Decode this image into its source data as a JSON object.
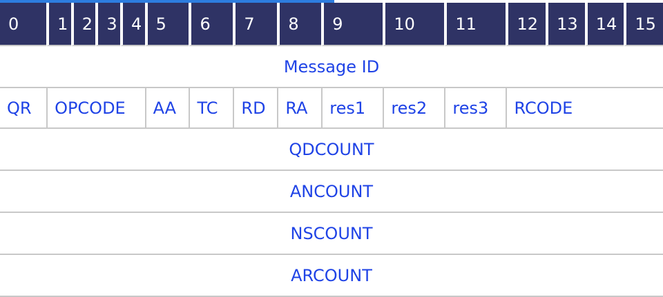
{
  "diagram": {
    "bit_positions": [
      "0",
      "1",
      "2",
      "3",
      "4",
      "5",
      "6",
      "7",
      "8",
      "9",
      "10",
      "11",
      "12",
      "13",
      "14",
      "15"
    ],
    "rows": [
      {
        "type": "full",
        "label": "Message ID"
      },
      {
        "type": "flags",
        "fields": [
          {
            "label": "QR",
            "span": 1
          },
          {
            "label": "OPCODE",
            "span": 4
          },
          {
            "label": "AA",
            "span": 1
          },
          {
            "label": "TC",
            "span": 1
          },
          {
            "label": "RD",
            "span": 1
          },
          {
            "label": "RA",
            "span": 1
          },
          {
            "label": "res1",
            "span": 1
          },
          {
            "label": "res2",
            "span": 1
          },
          {
            "label": "res3",
            "span": 1
          },
          {
            "label": "RCODE",
            "span": 4
          }
        ]
      },
      {
        "type": "full",
        "label": "QDCOUNT"
      },
      {
        "type": "full",
        "label": "ANCOUNT"
      },
      {
        "type": "full",
        "label": "NSCOUNT"
      },
      {
        "type": "full",
        "label": "ARCOUNT"
      }
    ]
  },
  "colors": {
    "header_bg": "#2f3365",
    "header_text": "#ffffff",
    "field_text": "#1f43e6",
    "divider": "#c8c8c8",
    "accent": "#2d7de0"
  }
}
